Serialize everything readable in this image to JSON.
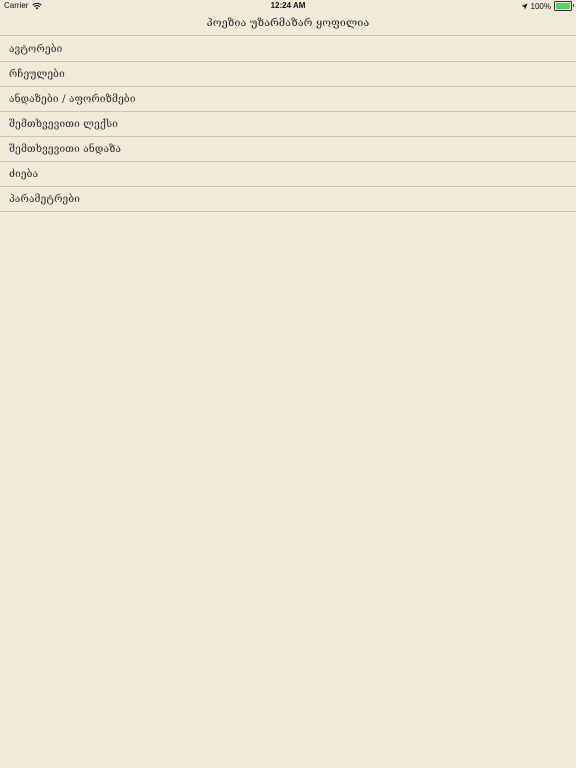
{
  "status_bar": {
    "carrier": "Carrier",
    "time": "12:24 AM",
    "battery": "100%",
    "battery_level": 1.0,
    "battery_color": "#4cd964"
  },
  "nav": {
    "title": "პოეზია უზარმაზარ ყოფილია"
  },
  "menu": {
    "items": [
      {
        "label": "ავტორები"
      },
      {
        "label": "რჩეულები"
      },
      {
        "label": "ანდაზები / აფორიზმები"
      },
      {
        "label": "შემთხვევითი ლექსი"
      },
      {
        "label": "შემთხვევითი ანდაზა"
      },
      {
        "label": "ძიება"
      },
      {
        "label": "პარამეტრები"
      }
    ]
  },
  "colors": {
    "background": "#f2e9d8",
    "separator": "#cdc5b6",
    "text": "#2a2a2a"
  }
}
